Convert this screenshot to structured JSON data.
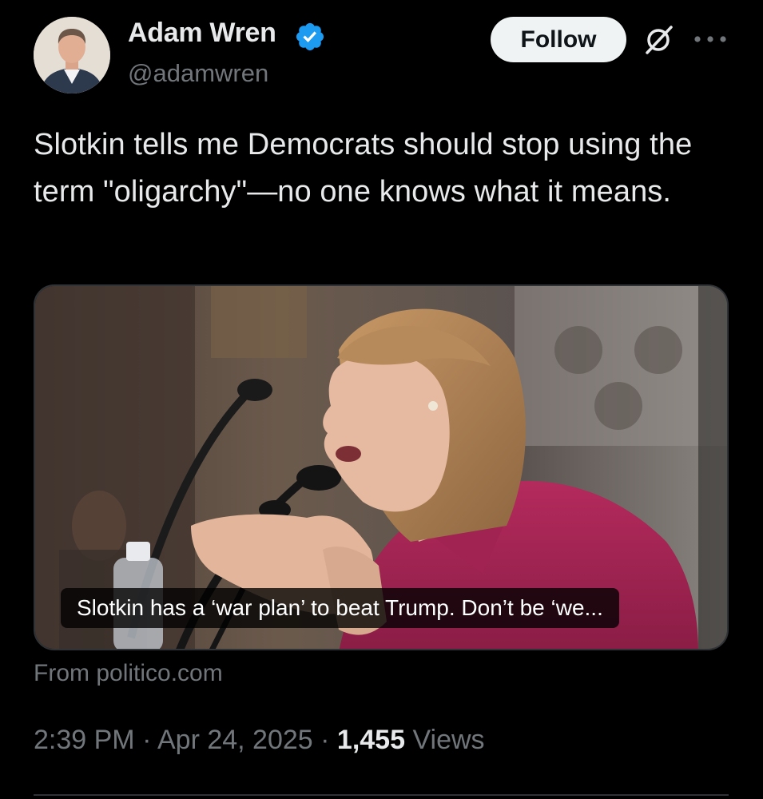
{
  "author": {
    "name": "Adam Wren",
    "handle": "@adamwren",
    "verified": true,
    "avatar_icon": "profile-photo"
  },
  "actions": {
    "follow_label": "Follow",
    "grok_icon": "grok-icon",
    "more_icon": "more-options-icon"
  },
  "tweet": {
    "text": "Slotkin tells me Democrats should stop using the term \"oligarchy\"—no one knows what it means."
  },
  "card": {
    "title": "Slotkin has a ‘war plan’ to beat Trump. Don’t be ‘we...",
    "source": "From politico.com"
  },
  "meta": {
    "time": "2:39 PM",
    "separator": "·",
    "date": "Apr 24, 2025",
    "views_count": "1,455",
    "views_label": "Views"
  },
  "colors": {
    "background": "#000000",
    "primary_text": "#e7e9ea",
    "secondary_text": "#71767b",
    "verified_blue": "#1d9bf0",
    "border": "#2f3336"
  }
}
